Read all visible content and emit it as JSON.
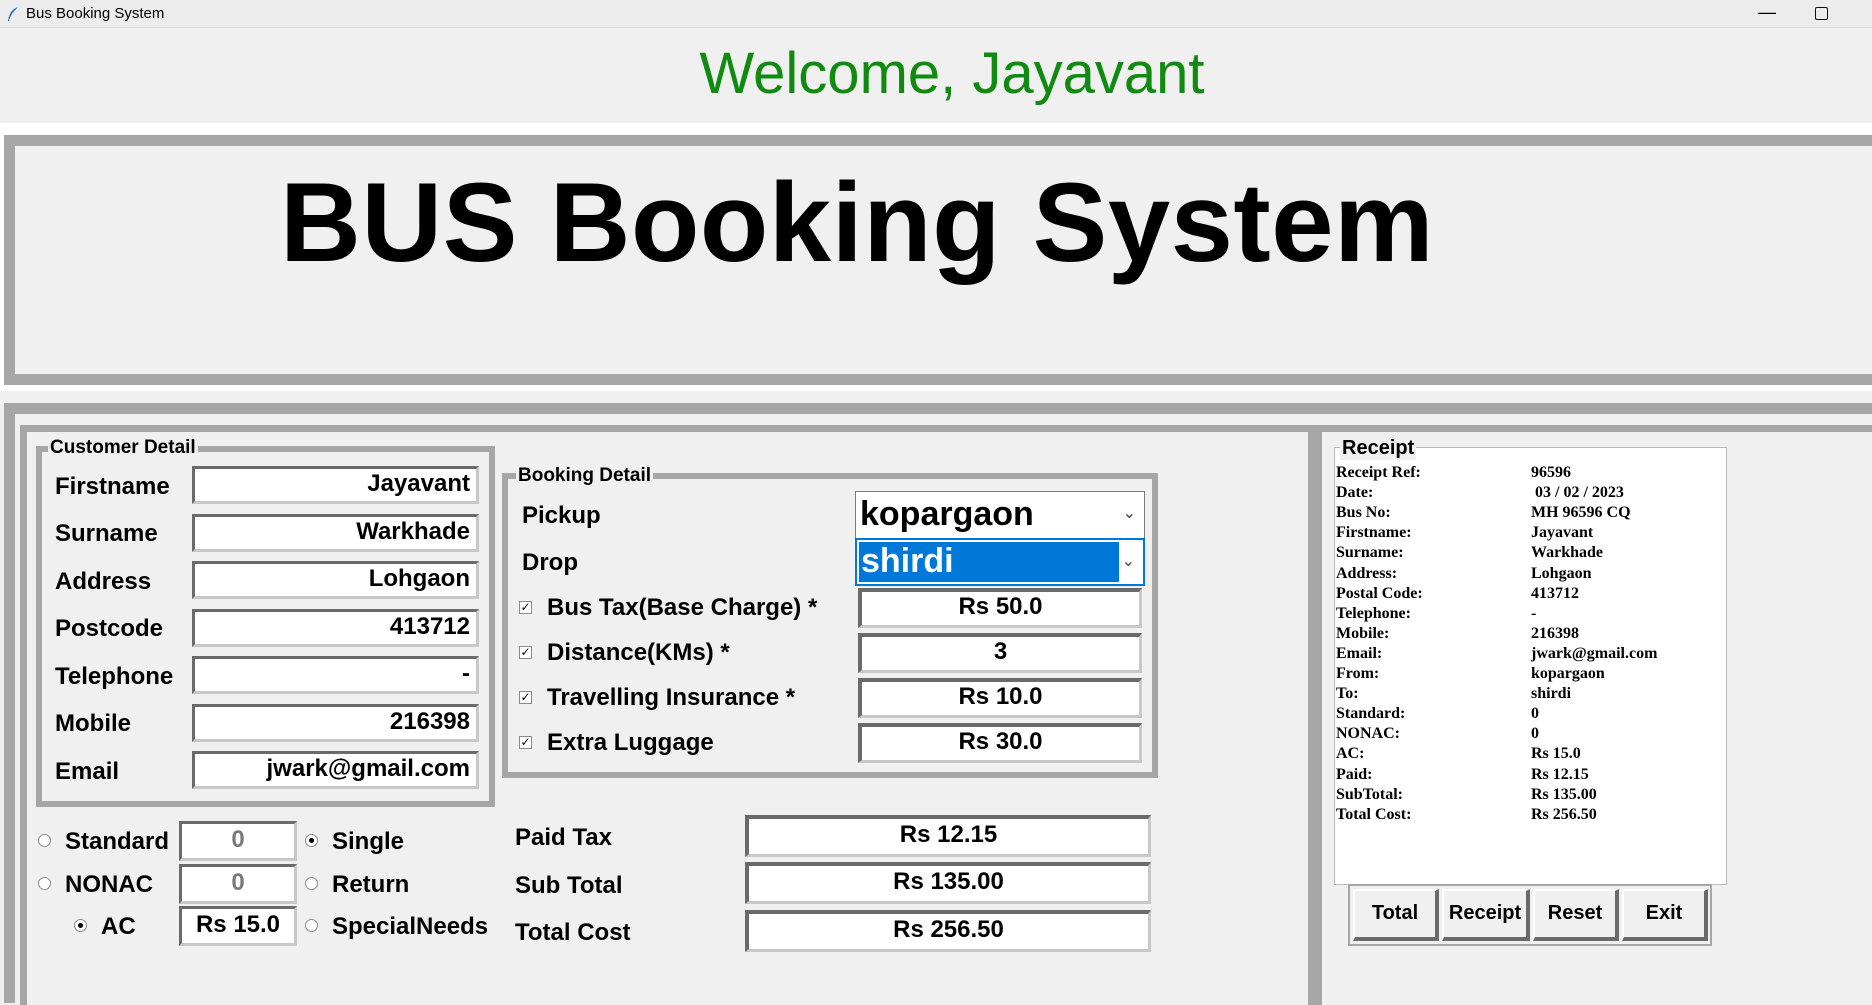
{
  "window": {
    "title": "Bus Booking System"
  },
  "welcome": "Welcome, Jayavant",
  "header": {
    "title": "BUS Booking System"
  },
  "customer": {
    "legend": "Customer Detail",
    "fields": [
      {
        "label": "Firstname",
        "value": "Jayavant"
      },
      {
        "label": "Surname",
        "value": "Warkhade"
      },
      {
        "label": "Address",
        "value": "Lohgaon"
      },
      {
        "label": "Postcode",
        "value": "413712"
      },
      {
        "label": "Telephone",
        "value": "-"
      },
      {
        "label": "Mobile",
        "value": "216398"
      },
      {
        "label": "Email",
        "value": "jwark@gmail.com"
      }
    ]
  },
  "booking": {
    "legend": "Booking Detail",
    "pickup": {
      "label": "Pickup",
      "value": "kopargaon"
    },
    "drop": {
      "label": "Drop",
      "value": "shirdi"
    },
    "charges": [
      {
        "label": "Bus Tax(Base Charge) *",
        "value": "Rs 50.0",
        "checked": true
      },
      {
        "label": "Distance(KMs) *",
        "value": "3",
        "checked": true
      },
      {
        "label": "Travelling Insurance *",
        "value": "Rs 10.0",
        "checked": true
      },
      {
        "label": "Extra Luggage",
        "value": "Rs 30.0",
        "checked": true
      }
    ]
  },
  "class_options": [
    {
      "label": "Standard",
      "value": "0",
      "selected": false
    },
    {
      "label": "NONAC",
      "value": "0",
      "selected": false
    },
    {
      "label": "AC",
      "value": "Rs 15.0",
      "selected": true
    }
  ],
  "trip_options": [
    {
      "label": "Single",
      "selected": true
    },
    {
      "label": "Return",
      "selected": false
    },
    {
      "label": "SpecialNeeds",
      "selected": false
    }
  ],
  "totals": [
    {
      "label": "Paid Tax",
      "value": "Rs 12.15"
    },
    {
      "label": "Sub Total",
      "value": "Rs 135.00"
    },
    {
      "label": "Total Cost",
      "value": "Rs 256.50"
    }
  ],
  "receipt": {
    "legend": "Receipt",
    "rows": [
      {
        "key": "Receipt Ref:",
        "value": "96596"
      },
      {
        "key": "Date:",
        "value": " 03 / 02 / 2023"
      },
      {
        "key": "Bus No:",
        "value": "MH 96596 CQ"
      },
      {
        "key": "Firstname:",
        "value": "Jayavant"
      },
      {
        "key": "Surname:",
        "value": "Warkhade"
      },
      {
        "key": "Address:",
        "value": "Lohgaon"
      },
      {
        "key": "Postal Code:",
        "value": "413712"
      },
      {
        "key": "Telephone:",
        "value": "-"
      },
      {
        "key": "Mobile:",
        "value": "216398"
      },
      {
        "key": "Email:",
        "value": "jwark@gmail.com"
      },
      {
        "key": "From:",
        "value": "kopargaon"
      },
      {
        "key": "To:",
        "value": "shirdi"
      },
      {
        "key": "Standard:",
        "value": "0"
      },
      {
        "key": "NONAC:",
        "value": "0"
      },
      {
        "key": "AC:",
        "value": "Rs 15.0"
      },
      {
        "key": "Paid:",
        "value": "Rs 12.15"
      },
      {
        "key": "SubTotal:",
        "value": "Rs 135.00"
      },
      {
        "key": "Total Cost:",
        "value": "Rs 256.50"
      }
    ]
  },
  "buttons": {
    "total": "Total",
    "receipt": "Receipt",
    "reset": "Reset",
    "exit": "Exit"
  },
  "colors": {
    "welcome": "#118a11",
    "frame": "#a6a6a6",
    "selection": "#0078d7"
  },
  "icons": {
    "app": "feather-icon",
    "minimize": "minimize-icon",
    "maximize": "maximize-icon"
  }
}
